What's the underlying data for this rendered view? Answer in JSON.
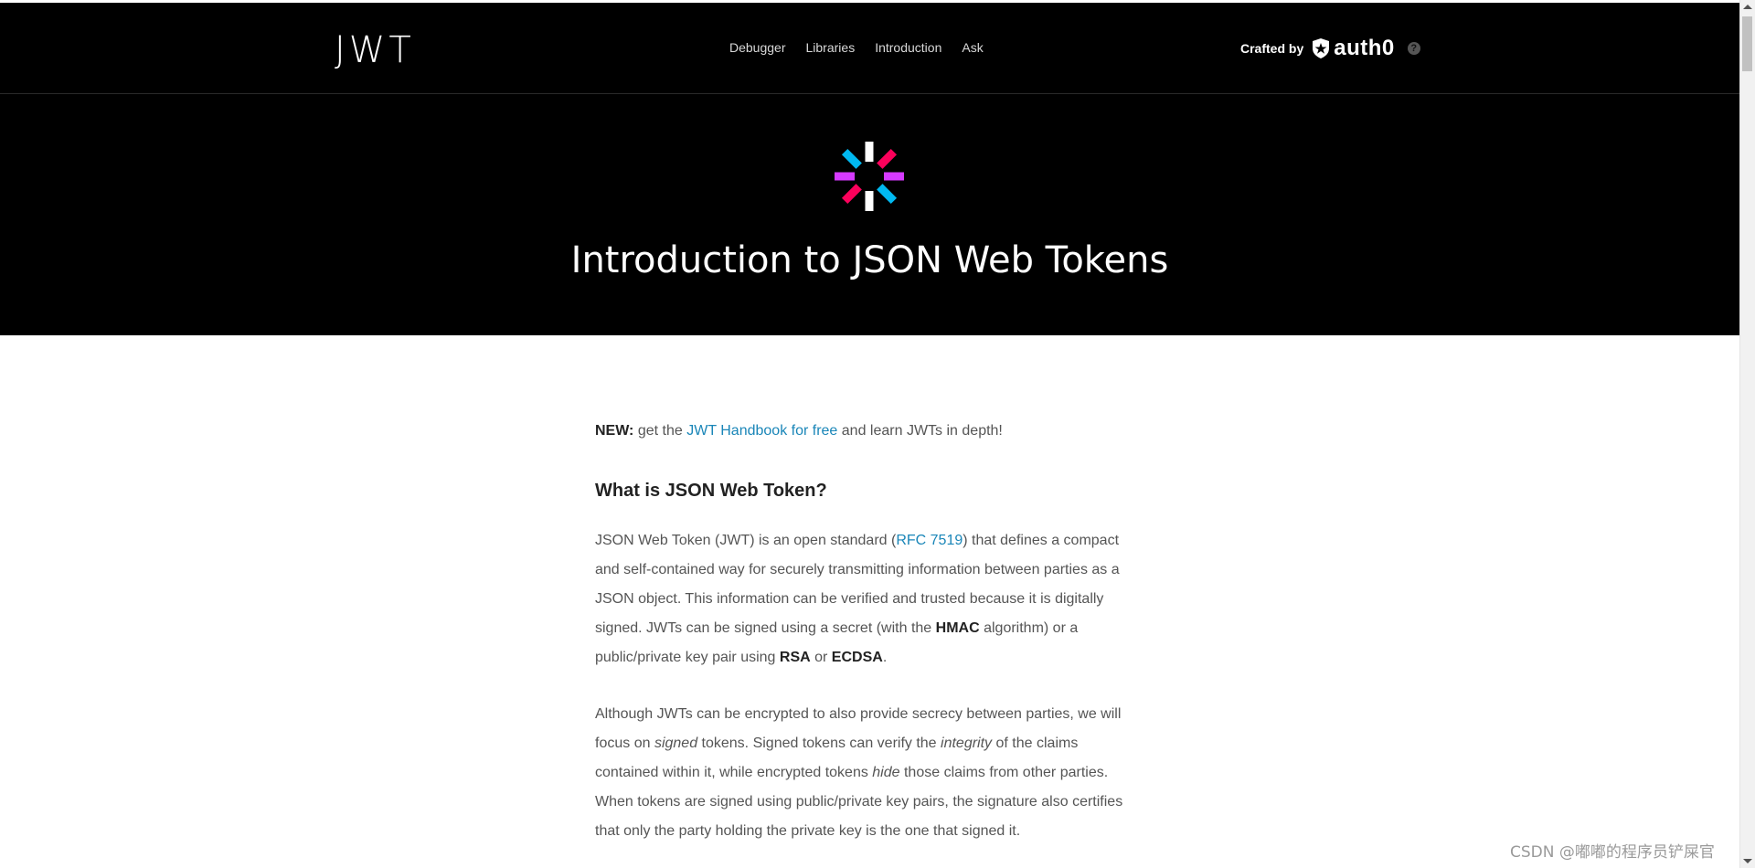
{
  "header": {
    "logo_text": "JWT",
    "nav": [
      "Debugger",
      "Libraries",
      "Introduction",
      "Ask"
    ],
    "crafted_by": "Crafted by",
    "brand": "auth0",
    "help_icon": "question-icon"
  },
  "hero": {
    "title": "Introduction to JSON Web Tokens",
    "logo_colors": [
      "#ffffff",
      "#fb015b",
      "#d63aff",
      "#00b9f1"
    ]
  },
  "article": {
    "new_label": "NEW:",
    "new_pre": "get the",
    "new_link": "JWT Handbook for free",
    "new_post": "and learn JWTs in depth!",
    "heading": "What is JSON Web Token?",
    "p1": {
      "a": "JSON Web Token (JWT) is an open standard (",
      "link": "RFC 7519",
      "b": ") that defines a compact and self-contained way for securely transmitting information between parties as a JSON object. This information can be verified and trusted because it is digitally signed. JWTs can be signed using a secret (with the ",
      "hmac": "HMAC",
      "c": " algorithm) or a public/private key pair using ",
      "rsa": "RSA",
      "d": " or ",
      "ecdsa": "ECDSA",
      "e": "."
    },
    "p2": {
      "a": "Although JWTs can be encrypted to also provide secrecy between parties, we will focus on ",
      "signed": "signed",
      "b": " tokens. Signed tokens can verify the ",
      "integrity": "integrity",
      "c": " of the claims contained within it, while encrypted tokens ",
      "hide": "hide",
      "d": " those claims from other parties. When tokens are signed using public/private key pairs, the signature also certifies that only the party holding the private key is the one that signed it."
    }
  },
  "watermark": "CSDN @嘟嘟的程序员铲屎官"
}
